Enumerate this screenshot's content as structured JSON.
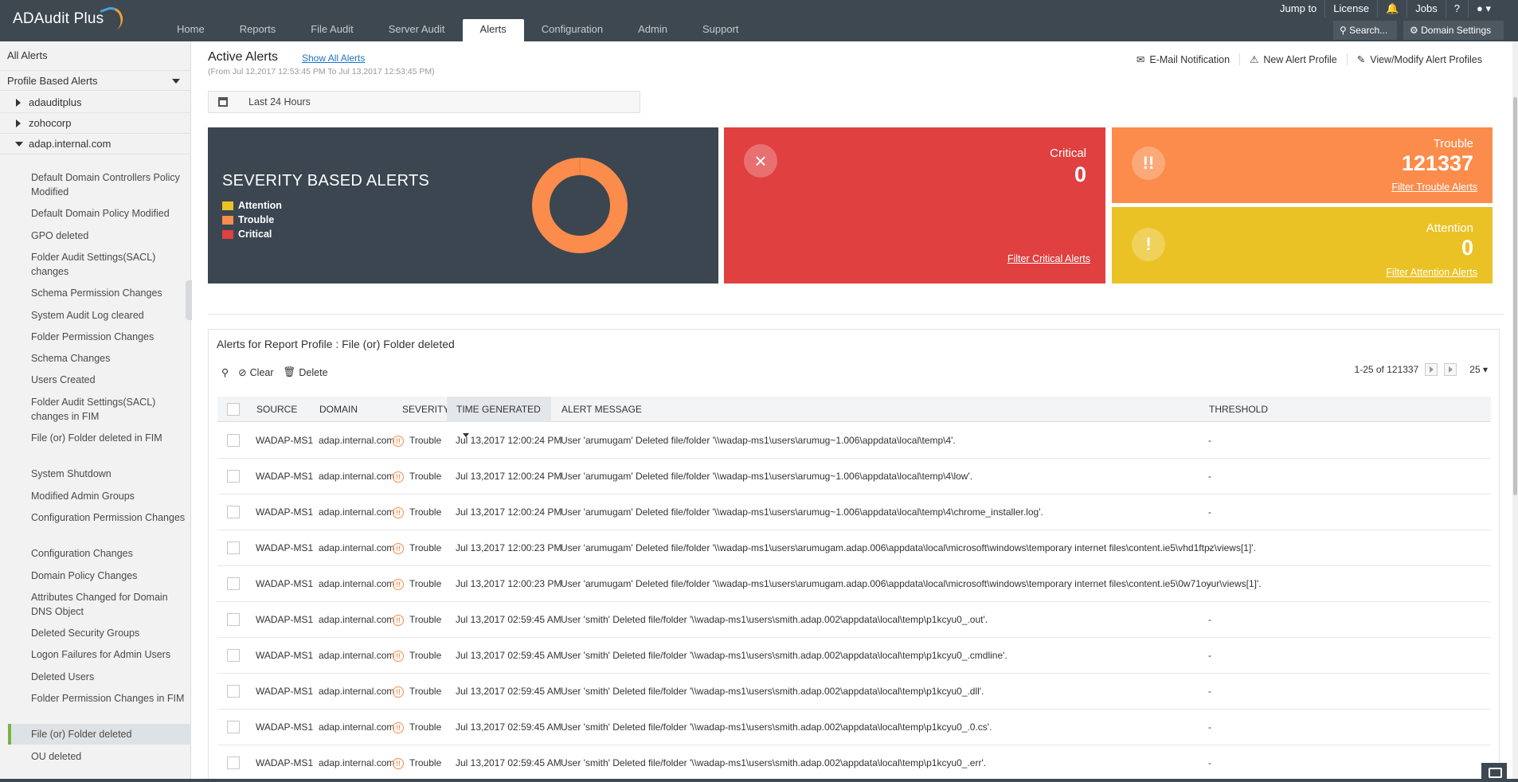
{
  "app": {
    "logo_text": "ADAudit Plus",
    "nav_tabs": [
      "Home",
      "Reports",
      "File Audit",
      "Server Audit",
      "Alerts",
      "Configuration",
      "Admin",
      "Support"
    ],
    "active_tab": "Alerts",
    "top_links": {
      "jump_to": "Jump to",
      "license": "License",
      "jobs": "Jobs",
      "help": "?"
    },
    "search_label": "Search...",
    "domain_settings_label": "Domain Settings"
  },
  "sidebar": {
    "all_alerts": "All Alerts",
    "profile_based": "Profile Based Alerts",
    "domains": [
      "adauditplus",
      "zohocorp",
      "adap.internal.com"
    ],
    "items": [
      "Default Domain Controllers Policy Modified",
      "Default Domain Policy Modified",
      "GPO deleted",
      "Folder Audit Settings(SACL) changes",
      "Schema Permission Changes",
      "System Audit Log cleared",
      "Folder Permission Changes",
      "Schema Changes",
      "Users Created",
      "Folder Audit Settings(SACL) changes in FIM",
      "File (or) Folder deleted in FIM",
      "System Shutdown",
      "Modified Admin Groups",
      "Configuration Permission Changes",
      "Configuration Changes",
      "Domain Policy Changes",
      "Attributes Changed for Domain DNS Object",
      "Deleted Security Groups",
      "Logon Failures for Admin Users",
      "Deleted Users",
      "Folder Permission Changes in FIM",
      "File (or) Folder deleted",
      "OU deleted"
    ],
    "selected_item": "File (or) Folder deleted"
  },
  "header": {
    "title": "Active Alerts",
    "show_all": "Show All Alerts",
    "range": "(From Jul 12,2017 12:53:45 PM To Jul 13,2017 12:53:45 PM)",
    "actions": [
      "E-Mail Notification",
      "New Alert Profile",
      "View/Modify Alert Profiles"
    ],
    "date_filter": "Last 24 Hours"
  },
  "severity": {
    "title": "SEVERITY BASED ALERTS",
    "legend": [
      {
        "label": "Attention",
        "color": "#ebc225"
      },
      {
        "label": "Trouble",
        "color": "#fb8c4c"
      },
      {
        "label": "Critical",
        "color": "#e04040"
      }
    ]
  },
  "chart_data": {
    "type": "pie",
    "categories": [
      "Attention",
      "Trouble",
      "Critical"
    ],
    "values": [
      0,
      121337,
      0
    ],
    "title": "SEVERITY BASED ALERTS"
  },
  "cards": {
    "critical": {
      "label": "Critical",
      "count": "0",
      "link": "Filter Critical Alerts",
      "color": "#e04040"
    },
    "trouble": {
      "label": "Trouble",
      "count": "121337",
      "link": "Filter Trouble Alerts",
      "color": "#fb8c4c"
    },
    "attention": {
      "label": "Attention",
      "count": "0",
      "link": "Filter Attention Alerts",
      "color": "#ebc225"
    }
  },
  "report": {
    "title": "Alerts for Report Profile : File (or) Folder deleted",
    "clear": "Clear",
    "delete": "Delete",
    "paging": "1-25 of 121337",
    "page_size": "25",
    "columns": [
      "SOURCE",
      "DOMAIN",
      "SEVERITY",
      "TIME GENERATED",
      "ALERT MESSAGE",
      "THRESHOLD"
    ],
    "rows": [
      [
        "WADAP-MS1",
        "adap.internal.com",
        "Trouble",
        "Jul 13,2017 12:00:24 PM",
        "User 'arumugam' Deleted file/folder '\\\\wadap-ms1\\users\\arumug~1.006\\appdata\\local\\temp\\4'.",
        "-"
      ],
      [
        "WADAP-MS1",
        "adap.internal.com",
        "Trouble",
        "Jul 13,2017 12:00:24 PM",
        "User 'arumugam' Deleted file/folder '\\\\wadap-ms1\\users\\arumug~1.006\\appdata\\local\\temp\\4\\low'.",
        "-"
      ],
      [
        "WADAP-MS1",
        "adap.internal.com",
        "Trouble",
        "Jul 13,2017 12:00:24 PM",
        "User 'arumugam' Deleted file/folder '\\\\wadap-ms1\\users\\arumug~1.006\\appdata\\local\\temp\\4\\chrome_installer.log'.",
        "-"
      ],
      [
        "WADAP-MS1",
        "adap.internal.com",
        "Trouble",
        "Jul 13,2017 12:00:23 PM",
        "User 'arumugam' Deleted file/folder '\\\\wadap-ms1\\users\\arumugam.adap.006\\appdata\\local\\microsoft\\windows\\temporary internet files\\content.ie5\\vhd1ftpz\\views[1]'.",
        "-"
      ],
      [
        "WADAP-MS1",
        "adap.internal.com",
        "Trouble",
        "Jul 13,2017 12:00:23 PM",
        "User 'arumugam' Deleted file/folder '\\\\wadap-ms1\\users\\arumugam.adap.006\\appdata\\local\\microsoft\\windows\\temporary internet files\\content.ie5\\0w71oyur\\views[1]'.",
        "-"
      ],
      [
        "WADAP-MS1",
        "adap.internal.com",
        "Trouble",
        "Jul 13,2017 02:59:45 AM",
        "User 'smith' Deleted file/folder '\\\\wadap-ms1\\users\\smith.adap.002\\appdata\\local\\temp\\p1kcyu0_.out'.",
        "-"
      ],
      [
        "WADAP-MS1",
        "adap.internal.com",
        "Trouble",
        "Jul 13,2017 02:59:45 AM",
        "User 'smith' Deleted file/folder '\\\\wadap-ms1\\users\\smith.adap.002\\appdata\\local\\temp\\p1kcyu0_.cmdline'.",
        "-"
      ],
      [
        "WADAP-MS1",
        "adap.internal.com",
        "Trouble",
        "Jul 13,2017 02:59:45 AM",
        "User 'smith' Deleted file/folder '\\\\wadap-ms1\\users\\smith.adap.002\\appdata\\local\\temp\\p1kcyu0_.dll'.",
        "-"
      ],
      [
        "WADAP-MS1",
        "adap.internal.com",
        "Trouble",
        "Jul 13,2017 02:59:45 AM",
        "User 'smith' Deleted file/folder '\\\\wadap-ms1\\users\\smith.adap.002\\appdata\\local\\temp\\p1kcyu0_.0.cs'.",
        "-"
      ],
      [
        "WADAP-MS1",
        "adap.internal.com",
        "Trouble",
        "Jul 13,2017 02:59:45 AM",
        "User 'smith' Deleted file/folder '\\\\wadap-ms1\\users\\smith.adap.002\\appdata\\local\\temp\\p1kcyu0_.err'.",
        "-"
      ]
    ]
  }
}
